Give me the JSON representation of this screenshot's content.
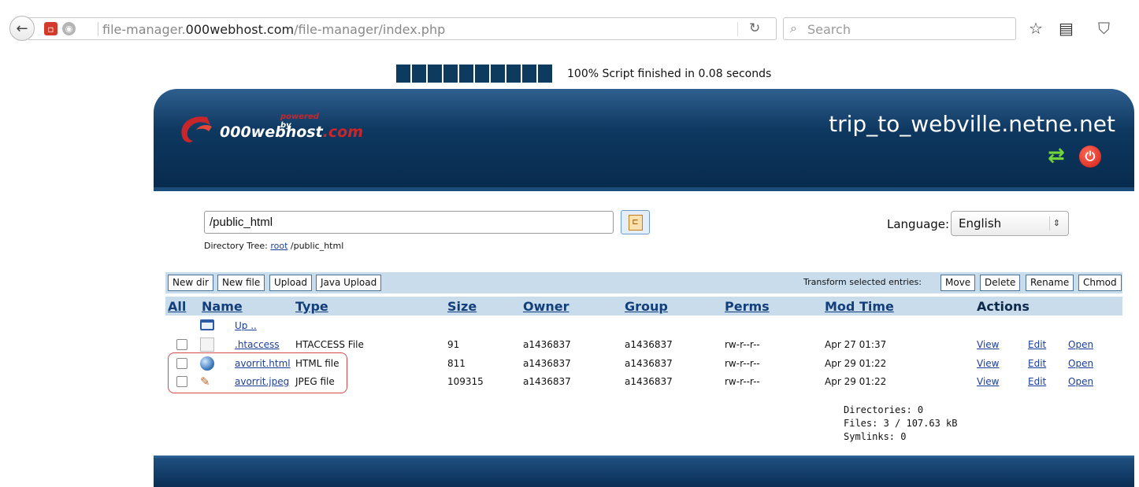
{
  "browser": {
    "url_prefix": "file-manager.",
    "url_domain": "000webhost.com",
    "url_path": "/file-manager/index.php",
    "search_placeholder": "Search"
  },
  "progress": {
    "percent": 100,
    "label": "100% Script finished in 0.08 seconds"
  },
  "header": {
    "logo_powered": "powered",
    "logo_by": "by",
    "logo_brand": "000webhost",
    "logo_tld": ".com",
    "site_title": "trip_to_webville.netne.net"
  },
  "directory": {
    "path_value": "/public_html",
    "tree_label": "Directory Tree:",
    "tree_root": "root",
    "tree_rest": "/public_html"
  },
  "language": {
    "label": "Language:",
    "selected": "English"
  },
  "toolbar": {
    "new_dir": "New dir",
    "new_file": "New file",
    "upload": "Upload",
    "java_upload": "Java Upload",
    "transform_label": "Transform selected entries:",
    "move": "Move",
    "delete": "Delete",
    "rename": "Rename",
    "chmod": "Chmod"
  },
  "columns": {
    "all": "All",
    "name": "Name",
    "type": "Type",
    "size": "Size",
    "owner": "Owner",
    "group": "Group",
    "perms": "Perms",
    "mod_time": "Mod Time",
    "actions": "Actions"
  },
  "up_label": "Up ..",
  "files": [
    {
      "name": ".htaccess",
      "type": "HTACCESS File",
      "size": "91",
      "owner": "a1436837",
      "group": "a1436837",
      "perms": "rw-r--r--",
      "mod_time": "Apr 27 01:37",
      "view": "View",
      "edit": "Edit",
      "open": "Open",
      "icon": "blank-file-icon"
    },
    {
      "name": "avorrit.html",
      "type": "HTML file",
      "size": "811",
      "owner": "a1436837",
      "group": "a1436837",
      "perms": "rw-r--r--",
      "mod_time": "Apr 29 01:22",
      "view": "View",
      "edit": "Edit",
      "open": "Open",
      "icon": "html-file-icon"
    },
    {
      "name": "avorrit.jpeg",
      "type": "JPEG file",
      "size": "109315",
      "owner": "a1436837",
      "group": "a1436837",
      "perms": "rw-r--r--",
      "mod_time": "Apr 29 01:22",
      "view": "View",
      "edit": "Edit",
      "open": "Open",
      "icon": "image-file-icon"
    }
  ],
  "summary": {
    "directories": "Directories: 0",
    "files": "Files: 3 / 107.63 kB",
    "symlinks": "Symlinks: 0"
  },
  "colors": {
    "header_navy": "#0e3860",
    "toolbar_blue": "#c9dcec",
    "link_blue": "#1b3f9a",
    "highlight_red": "#d84a4a"
  }
}
